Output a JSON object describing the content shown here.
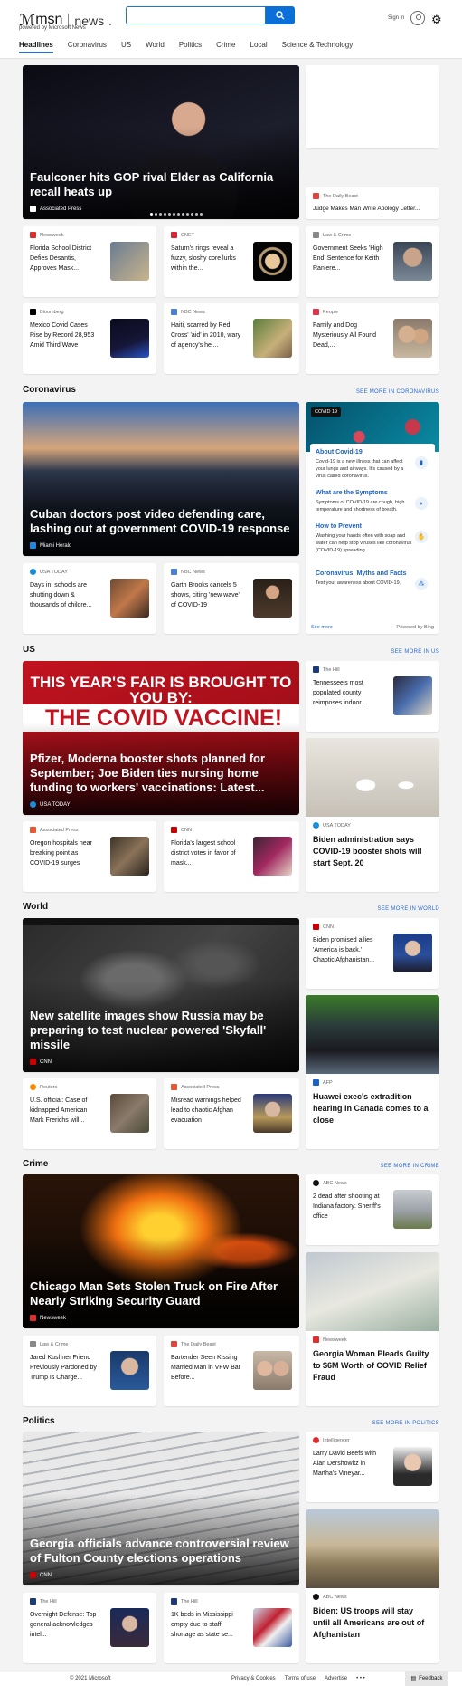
{
  "header": {
    "logo_msn": "msn",
    "logo_news": "news",
    "powered_by": "powered by Microsoft News",
    "search_value": "",
    "signin": "Sign in"
  },
  "nav": [
    "Headlines",
    "Coronavirus",
    "US",
    "World",
    "Politics",
    "Crime",
    "Local",
    "Science & Technology"
  ],
  "top": {
    "hero": {
      "title": "Faulconer hits GOP rival Elder as California recall heats up",
      "source": "Associated Press"
    },
    "side_top": {
      "source": "The Daily Beast",
      "title": "Judge Makes Man Write Apology Letter..."
    },
    "small": [
      {
        "source": "Newsweek",
        "title": "Florida School District Defies Desantis, Approves Mask..."
      },
      {
        "source": "CNET",
        "title": "Saturn's rings reveal a fuzzy, sloshy core lurks within the..."
      },
      {
        "source": "Law & Crime",
        "title": "Government Seeks 'High End' Sentence for Keith Raniere..."
      },
      {
        "source": "Bloomberg",
        "title": "Mexico Covid Cases Rise by Record 28,953 Amid Third Wave"
      },
      {
        "source": "NBC News",
        "title": "Haiti, scarred by Red Cross' 'aid' in 2010, wary of agency's hel..."
      },
      {
        "source": "People",
        "title": "Family and Dog Mysteriously All Found Dead,..."
      }
    ]
  },
  "coronavirus": {
    "heading": "Coronavirus",
    "more": "SEE MORE IN CORONAVIRUS",
    "hero": {
      "title": "Cuban doctors post video defending care, lashing out at government COVID-19 response",
      "source": "Miami Herald"
    },
    "small": [
      {
        "source": "USA TODAY",
        "title": "Days in, schools are shutting down & thousands of childre..."
      },
      {
        "source": "NBC News",
        "title": "Garth Brooks cancels 5 shows, citing 'new wave' of COVID-19"
      }
    ],
    "panel": {
      "tag": "COVID 19",
      "items": [
        {
          "h": "About Covid-19",
          "d": "Covid-19 is a new illness that can affect your lungs and airways. It's caused by a virus called coronavirus."
        },
        {
          "h": "What are the Symptoms",
          "d": "Symptoms of COVID-19 are cough, high temperature and shortness of breath."
        },
        {
          "h": "How to Prevent",
          "d": "Washing your hands often with soap and water can help stop viruses like coronavirus (COVID-19) spreading."
        },
        {
          "h": "Coronavirus: Myths and Facts",
          "d": "Test your awareness about COVID-19."
        }
      ],
      "see_more": "See more",
      "powered": "Powered by Bing"
    }
  },
  "us": {
    "heading": "US",
    "more": "SEE MORE IN US",
    "hero": {
      "title": "Pfizer, Moderna booster shots planned for September; Joe Biden ties nursing home funding to workers' vaccinations: Latest...",
      "source": "USA TODAY",
      "sign1": "THIS YEAR'S FAIR IS BROUGHT TO YOU BY:",
      "sign2": "THE COVID VACCINE!"
    },
    "side_small": {
      "source": "The Hill",
      "title": "Tennessee's most populated county reimposes indoor..."
    },
    "side_big": {
      "source": "USA TODAY",
      "title": "Biden administration says COVID-19 booster shots will start Sept. 20"
    },
    "small": [
      {
        "source": "Associated Press",
        "title": "Oregon hospitals near breaking point as COVID-19 surges"
      },
      {
        "source": "CNN",
        "title": "Florida's largest school district votes in favor of mask..."
      }
    ]
  },
  "world": {
    "heading": "World",
    "more": "SEE MORE IN WORLD",
    "hero": {
      "title": "New satellite images show Russia may be preparing to test nuclear powered 'Skyfall' missile",
      "source": "CNN"
    },
    "side_small": {
      "source": "CNN",
      "title": "Biden promised allies 'America is back.' Chaotic Afghanistan..."
    },
    "side_big": {
      "source": "AFP",
      "title": "Huawei exec's extradition hearing in Canada comes to a close"
    },
    "small": [
      {
        "source": "Reuters",
        "title": "U.S. official: Case of kidnapped American Mark Frerichs will..."
      },
      {
        "source": "Associated Press",
        "title": "Misread warnings helped lead to chaotic Afghan evacuation"
      }
    ]
  },
  "crime": {
    "heading": "Crime",
    "more": "SEE MORE IN CRIME",
    "hero": {
      "title": "Chicago Man Sets Stolen Truck on Fire After Nearly Striking Security Guard",
      "source": "Newsweek"
    },
    "side_small": {
      "source": "ABC News",
      "title": "2 dead after shooting at Indiana factory: Sheriff's office"
    },
    "side_big": {
      "source": "Newsweek",
      "title": "Georgia Woman Pleads Guilty to $6M Worth of COVID Relief Fraud"
    },
    "small": [
      {
        "source": "Law & Crime",
        "title": "Jared Kushner Friend Previously Pardoned by Trump Is Charge..."
      },
      {
        "source": "The Daily Beast",
        "title": "Bartender Seen Kissing Married Man in VFW Bar Before..."
      }
    ]
  },
  "politics": {
    "heading": "Politics",
    "more": "SEE MORE IN POLITICS",
    "hero": {
      "title": "Georgia officials advance controversial review of Fulton County elections operations",
      "source": "CNN"
    },
    "side_small": {
      "source": "Intelligencer",
      "title": "Larry David Beefs with Alan Dershowitz in Martha's Vineyar..."
    },
    "side_big": {
      "source": "ABC News",
      "title": "Biden: US troops will stay until all Americans are out of Afghanistan"
    },
    "small": [
      {
        "source": "The Hill",
        "title": "Overnight Defense: Top general acknowledges intel..."
      },
      {
        "source": "The Hill",
        "title": "1K beds in Mississippi empty due to staff shortage as state se..."
      }
    ]
  },
  "footer": {
    "copyright": "© 2021 Microsoft",
    "links": [
      "Privacy & Cookies",
      "Terms of use",
      "Advertise",
      "• • •"
    ],
    "feedback": "Feedback"
  }
}
